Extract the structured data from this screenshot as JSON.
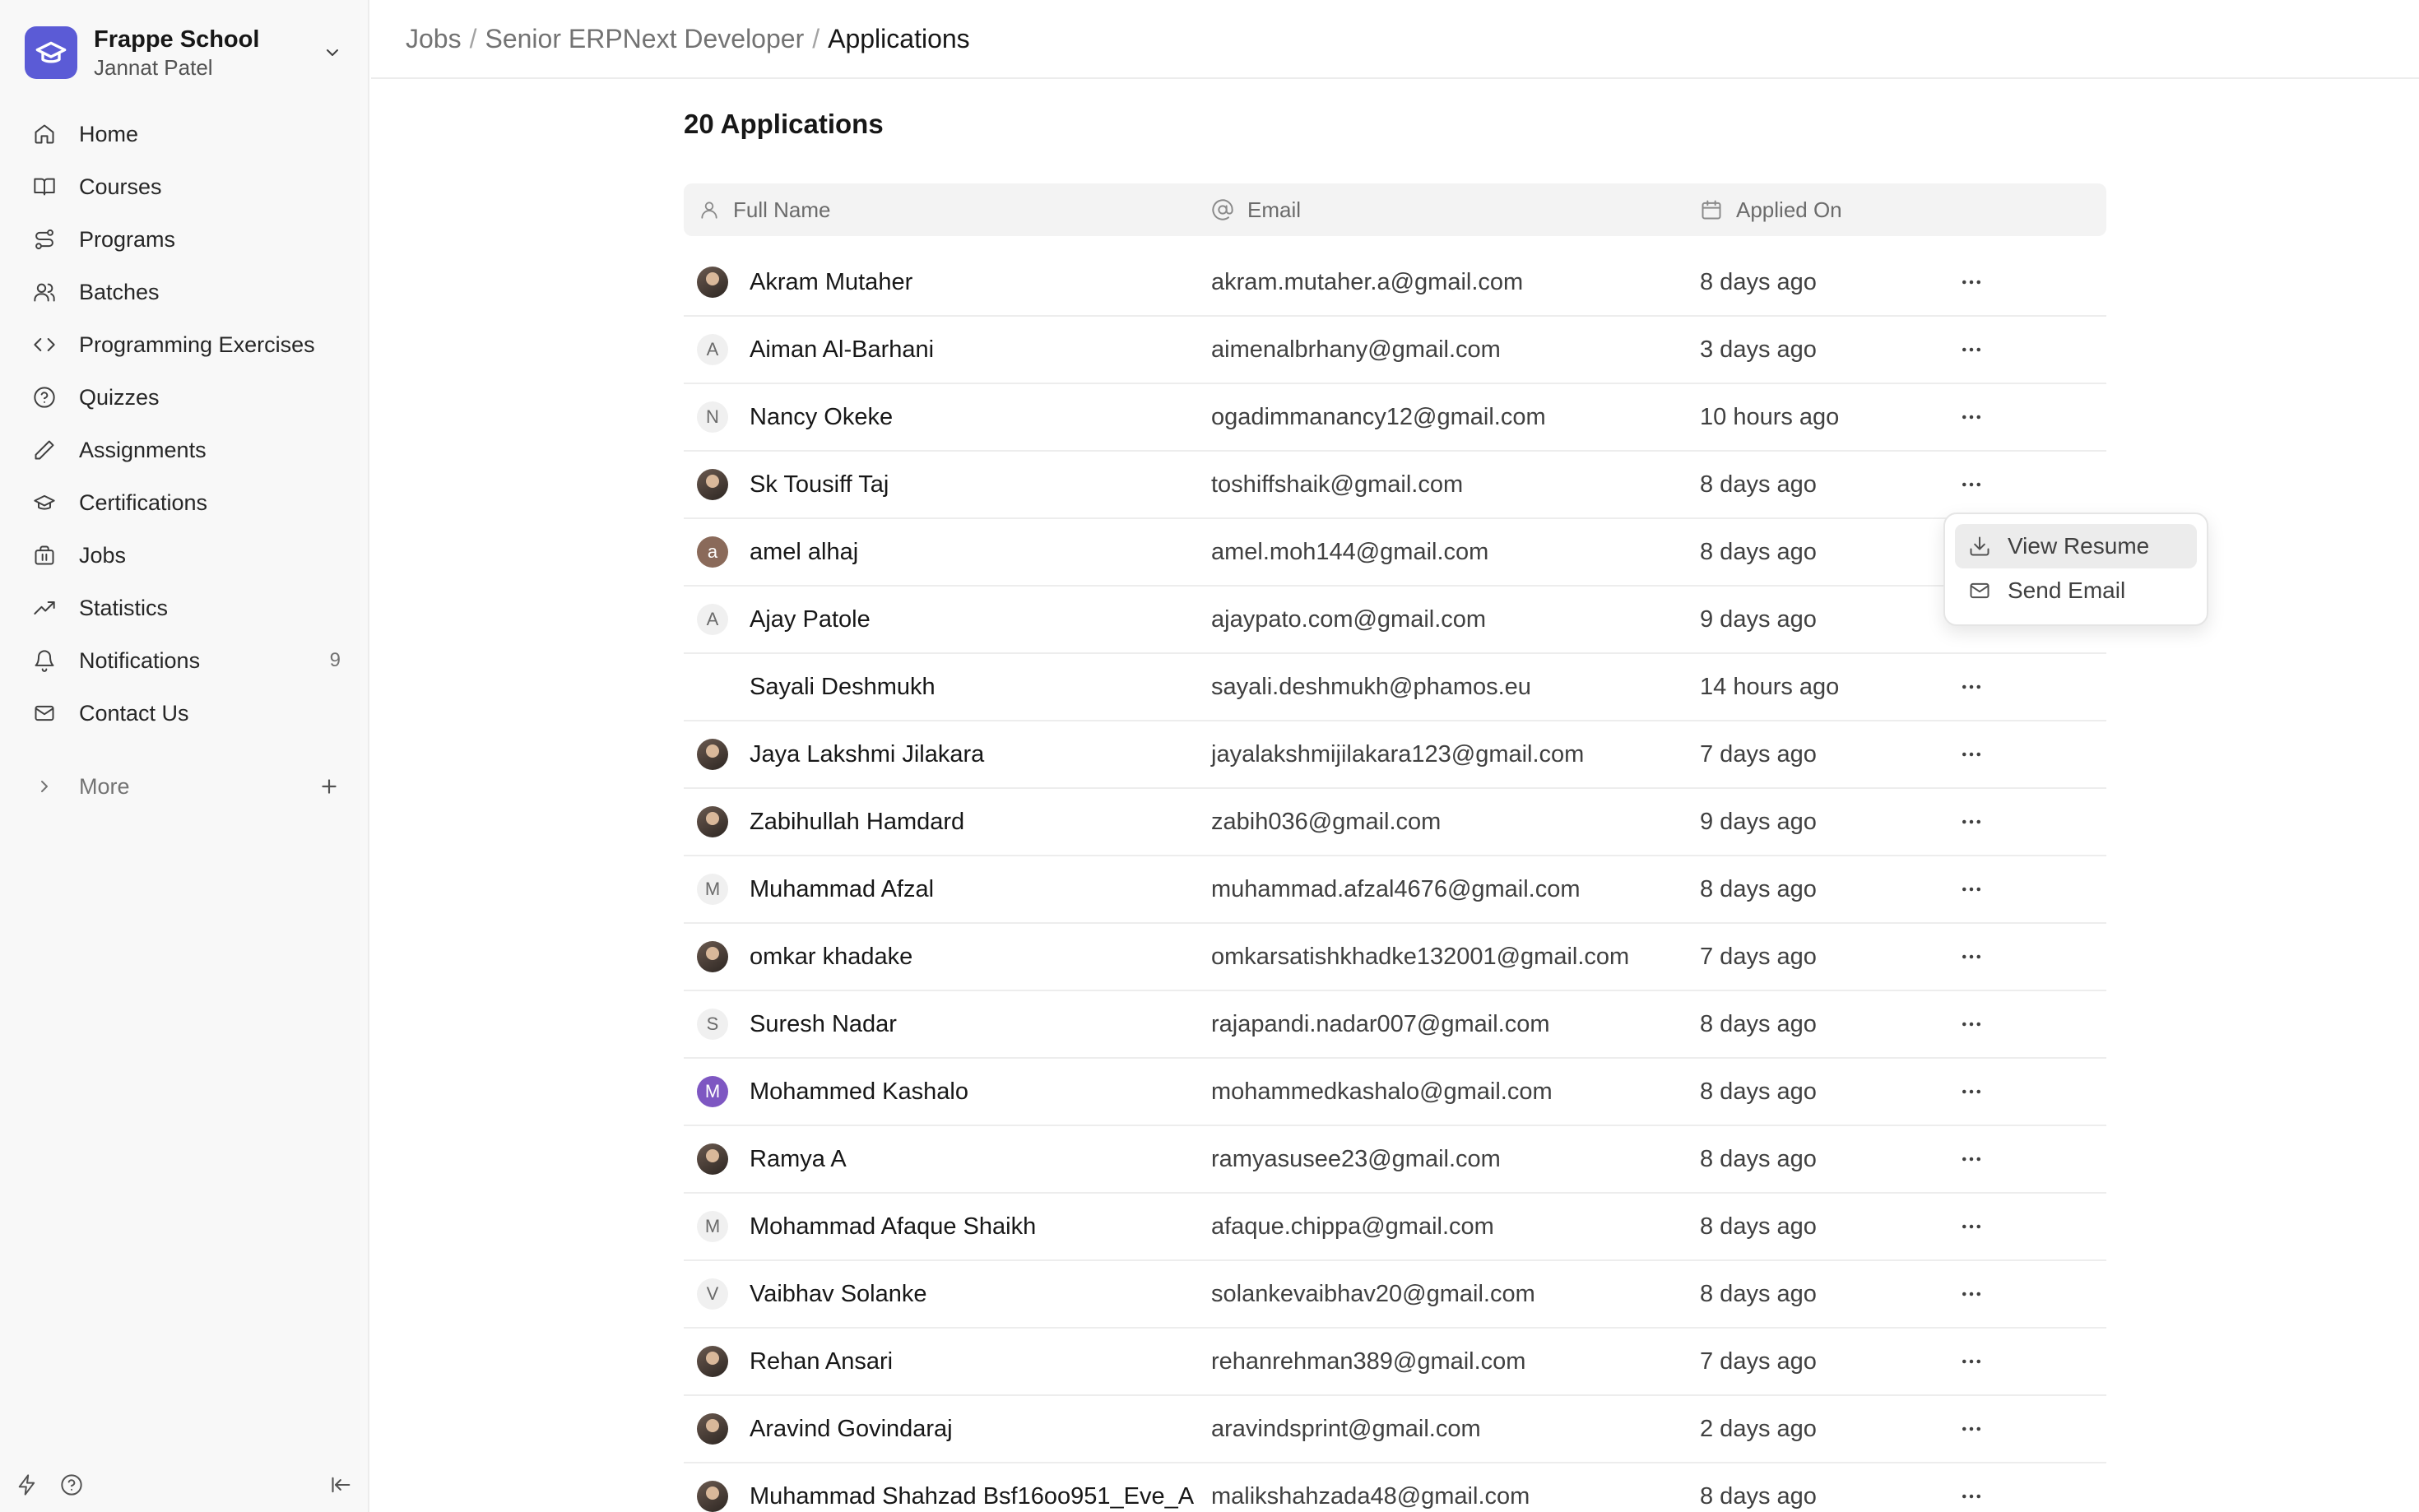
{
  "brand": {
    "name": "Frappe School",
    "user": "Jannat Patel"
  },
  "nav": [
    {
      "label": "Home",
      "icon": "home-icon"
    },
    {
      "label": "Courses",
      "icon": "book-icon"
    },
    {
      "label": "Programs",
      "icon": "route-icon"
    },
    {
      "label": "Batches",
      "icon": "users-icon"
    },
    {
      "label": "Programming Exercises",
      "icon": "code-icon"
    },
    {
      "label": "Quizzes",
      "icon": "help-circle-icon"
    },
    {
      "label": "Assignments",
      "icon": "pencil-icon"
    },
    {
      "label": "Certifications",
      "icon": "graduation-cap-icon"
    },
    {
      "label": "Jobs",
      "icon": "briefcase-icon"
    },
    {
      "label": "Statistics",
      "icon": "trending-up-icon"
    },
    {
      "label": "Notifications",
      "icon": "bell-icon",
      "badge": "9"
    },
    {
      "label": "Contact Us",
      "icon": "mail-icon"
    }
  ],
  "more": {
    "label": "More"
  },
  "breadcrumb": {
    "jobs": "Jobs",
    "job": "Senior ERPNext Developer",
    "current": "Applications",
    "separator": "/"
  },
  "page_title": "20 Applications",
  "table": {
    "columns": {
      "name": "Full Name",
      "email": "Email",
      "applied": "Applied On"
    },
    "rows": [
      {
        "name": "Akram Mutaher",
        "email": "akram.mutaher.a@gmail.com",
        "applied": "8 days ago",
        "avatar_type": "photo",
        "avatar_letter": ""
      },
      {
        "name": "Aiman Al-Barhani",
        "email": "aimenalbrhany@gmail.com",
        "applied": "3 days ago",
        "avatar_type": "letter",
        "avatar_letter": "A"
      },
      {
        "name": "Nancy Okeke",
        "email": "ogadimmanancy12@gmail.com",
        "applied": "10 hours ago",
        "avatar_type": "letter",
        "avatar_letter": "N"
      },
      {
        "name": "Sk Tousiff Taj",
        "email": "toshiffshaik@gmail.com",
        "applied": "8 days ago",
        "avatar_type": "photo",
        "avatar_letter": ""
      },
      {
        "name": "amel alhaj",
        "email": "amel.moh144@gmail.com",
        "applied": "8 days ago",
        "avatar_type": "brown",
        "avatar_letter": "a"
      },
      {
        "name": "Ajay Patole",
        "email": "ajaypato.com@gmail.com",
        "applied": "9 days ago",
        "avatar_type": "letter",
        "avatar_letter": "A"
      },
      {
        "name": "Sayali Deshmukh",
        "email": "sayali.deshmukh@phamos.eu",
        "applied": "14 hours ago",
        "avatar_type": "empty",
        "avatar_letter": ""
      },
      {
        "name": "Jaya Lakshmi Jilakara",
        "email": "jayalakshmijilakara123@gmail.com",
        "applied": "7 days ago",
        "avatar_type": "photo",
        "avatar_letter": ""
      },
      {
        "name": "Zabihullah Hamdard",
        "email": "zabih036@gmail.com",
        "applied": "9 days ago",
        "avatar_type": "photo",
        "avatar_letter": ""
      },
      {
        "name": "Muhammad Afzal",
        "email": "muhammad.afzal4676@gmail.com",
        "applied": "8 days ago",
        "avatar_type": "letter",
        "avatar_letter": "M"
      },
      {
        "name": "omkar khadake",
        "email": "omkarsatishkhadke132001@gmail.com",
        "applied": "7 days ago",
        "avatar_type": "photo",
        "avatar_letter": ""
      },
      {
        "name": "Suresh Nadar",
        "email": "rajapandi.nadar007@gmail.com",
        "applied": "8 days ago",
        "avatar_type": "letter",
        "avatar_letter": "S"
      },
      {
        "name": "Mohammed Kashalo",
        "email": "mohammedkashalo@gmail.com",
        "applied": "8 days ago",
        "avatar_type": "violet",
        "avatar_letter": "M"
      },
      {
        "name": "Ramya A",
        "email": "ramyasusee23@gmail.com",
        "applied": "8 days ago",
        "avatar_type": "photo",
        "avatar_letter": ""
      },
      {
        "name": "Mohammad Afaque Shaikh",
        "email": "afaque.chippa@gmail.com",
        "applied": "8 days ago",
        "avatar_type": "letter",
        "avatar_letter": "M"
      },
      {
        "name": "Vaibhav Solanke",
        "email": "solankevaibhav20@gmail.com",
        "applied": "8 days ago",
        "avatar_type": "letter",
        "avatar_letter": "V"
      },
      {
        "name": "Rehan Ansari",
        "email": "rehanrehman389@gmail.com",
        "applied": "7 days ago",
        "avatar_type": "photo",
        "avatar_letter": ""
      },
      {
        "name": "Aravind Govindaraj",
        "email": "aravindsprint@gmail.com",
        "applied": "2 days ago",
        "avatar_type": "photo",
        "avatar_letter": ""
      },
      {
        "name": "Muhammad Shahzad Bsf16oo951_Eve_A",
        "email": "malikshahzada48@gmail.com",
        "applied": "8 days ago",
        "avatar_type": "photo",
        "avatar_letter": ""
      }
    ]
  },
  "dropdown": {
    "view_resume": "View Resume",
    "send_email": "Send Email"
  },
  "colors": {
    "brand": "#5b5bd6",
    "avatar_violet": "#7e57c2",
    "sidebar_bg": "#f8f8f8"
  }
}
